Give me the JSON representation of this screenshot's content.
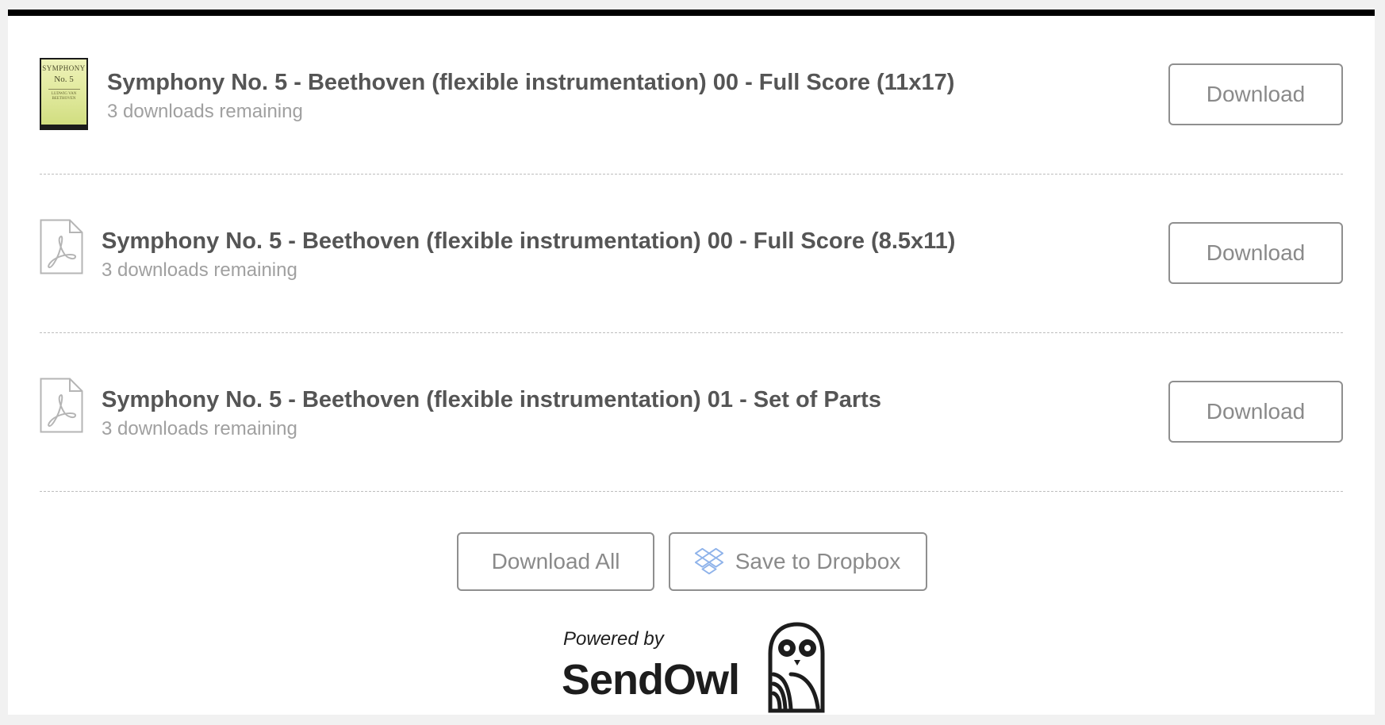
{
  "items": [
    {
      "title": "Symphony No. 5 - Beethoven (flexible instrumentation) 00 - Full Score (11x17)",
      "remaining": "3 downloads remaining",
      "button": "Download",
      "thumbnail": {
        "type": "cover",
        "line1": "SYMPHONY",
        "line2": "No. 5",
        "line3": "LUDWIG VAN BEETHOVEN"
      }
    },
    {
      "title": "Symphony No. 5 - Beethoven (flexible instrumentation) 00 - Full Score (8.5x11)",
      "remaining": "3 downloads remaining",
      "button": "Download",
      "thumbnail": {
        "type": "pdf-icon"
      }
    },
    {
      "title": "Symphony No. 5 - Beethoven (flexible instrumentation) 01 - Set of Parts",
      "remaining": "3 downloads remaining",
      "button": "Download",
      "thumbnail": {
        "type": "pdf-icon"
      }
    }
  ],
  "actions": {
    "download_all": "Download All",
    "dropbox": "Save to Dropbox",
    "dropbox_icon": "dropbox-icon"
  },
  "footer": {
    "powered_by": "Powered by",
    "brand": "SendOwl",
    "logo_icon": "owl-icon"
  },
  "colors": {
    "top_border": "#000000",
    "title": "#555555",
    "subtitle": "#a0a0a0",
    "button_border": "#8f8f8f",
    "dropbox_blue": "#8fb3ea"
  }
}
